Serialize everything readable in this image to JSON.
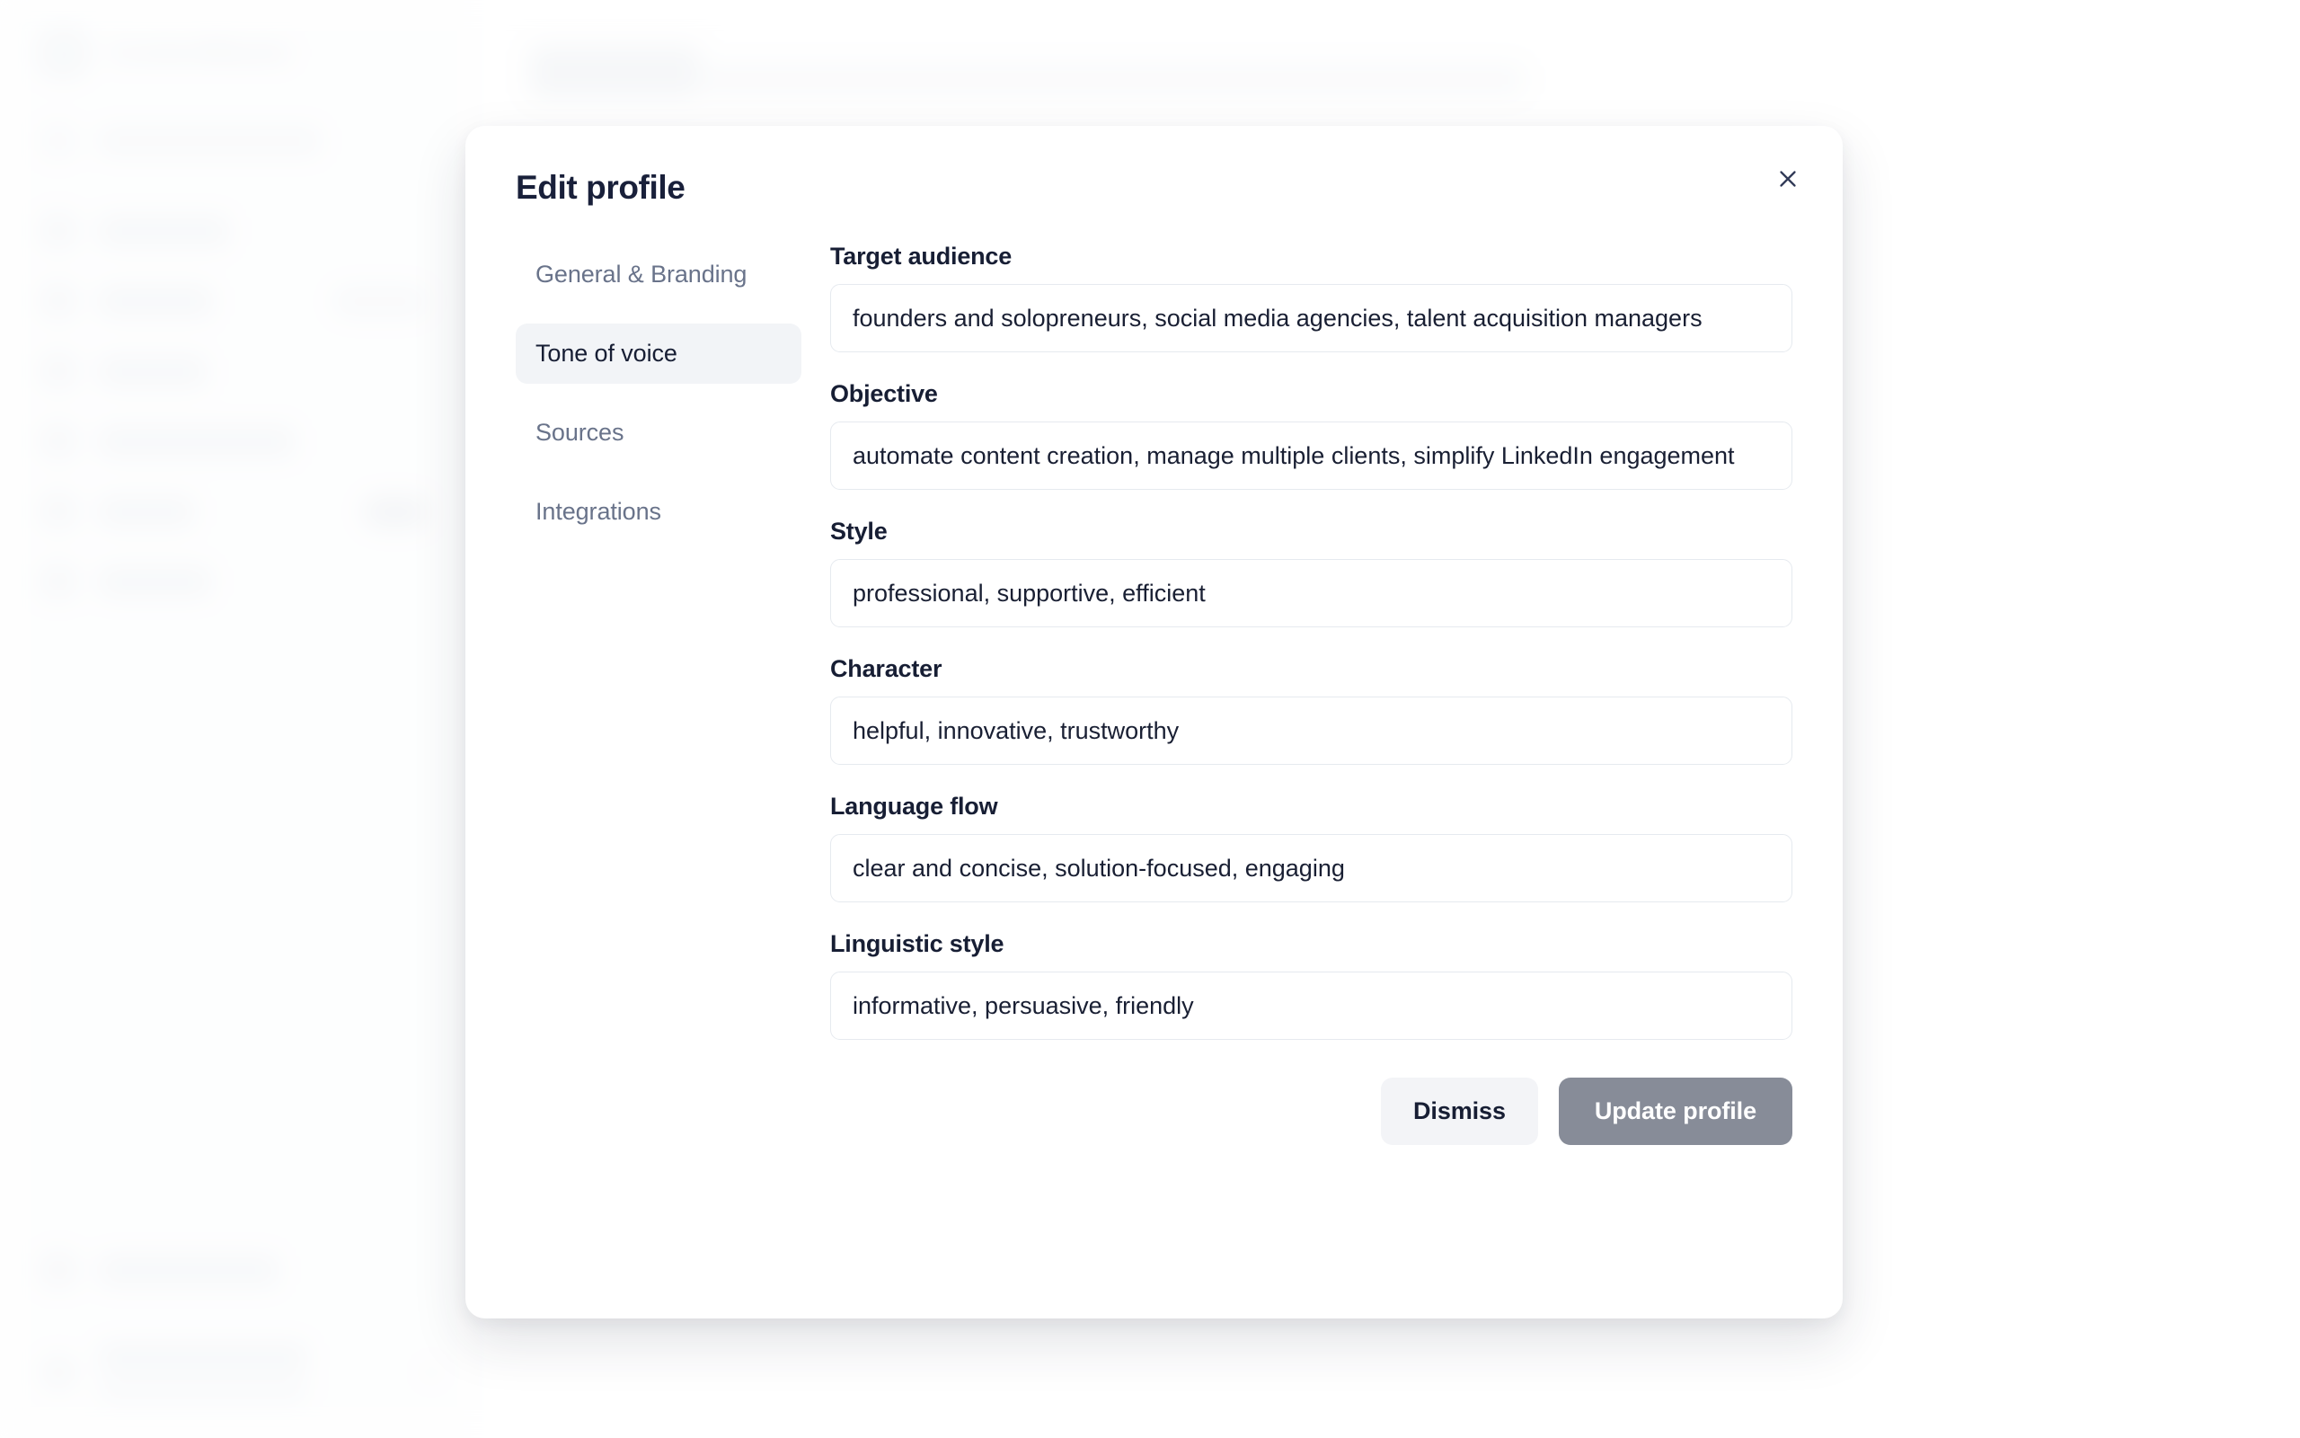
{
  "background": {
    "brand_name": "ContentMaster",
    "sidebar_top": [
      {
        "label": "New content assistant",
        "icon": "plus-icon"
      }
    ],
    "sidebar_items": [
      {
        "label": "Dashboard",
        "icon": "grid-icon",
        "tag": ""
      },
      {
        "label": "Assistant",
        "icon": "sparkle-icon",
        "tag": "Preview"
      },
      {
        "label": "All posts",
        "icon": "document-icon",
        "tag": ""
      },
      {
        "label": "Content calendar",
        "icon": "calendar-icon",
        "tag": ""
      },
      {
        "label": "Profiles",
        "icon": "user-icon",
        "tag": "New"
      },
      {
        "label": "Analytics",
        "icon": "chart-icon",
        "tag": ""
      }
    ],
    "sidebar_bottom": [
      {
        "label": "Leave feedback",
        "icon": "megaphone-icon"
      }
    ],
    "account": {
      "name": "ContentMaster",
      "email": "contact@contentmaster.io",
      "more_icon": "ellipsis-icon"
    },
    "page_title": "Profiles",
    "page_description": "Define your profiles, tone, and voice so the content connects with the right audience."
  },
  "modal": {
    "title": "Edit profile",
    "close_icon": "close-icon",
    "tabs": [
      {
        "id": "general-branding",
        "label": "General & Branding",
        "active": false
      },
      {
        "id": "tone-of-voice",
        "label": "Tone of voice",
        "active": true
      },
      {
        "id": "sources",
        "label": "Sources",
        "active": false
      },
      {
        "id": "integrations",
        "label": "Integrations",
        "active": false
      }
    ],
    "fields": [
      {
        "id": "target-audience",
        "label": "Target audience",
        "value": "founders and solopreneurs, social media agencies, talent acquisition managers",
        "placeholder": "Target audience"
      },
      {
        "id": "objective",
        "label": "Objective",
        "value": "automate content creation, manage multiple clients, simplify LinkedIn engagement",
        "placeholder": "Objective"
      },
      {
        "id": "style",
        "label": "Style",
        "value": "professional, supportive, efficient",
        "placeholder": "Style"
      },
      {
        "id": "character",
        "label": "Character",
        "value": "helpful, innovative, trustworthy",
        "placeholder": "Character"
      },
      {
        "id": "language-flow",
        "label": "Language flow",
        "value": "clear and concise, solution-focused, engaging",
        "placeholder": "Language flow"
      },
      {
        "id": "linguistic-style",
        "label": "Linguistic style",
        "value": "informative, persuasive, friendly",
        "placeholder": "Linguistic style"
      }
    ],
    "footer": {
      "dismiss_label": "Dismiss",
      "update_label": "Update profile"
    }
  },
  "colors": {
    "text_primary": "#171e34",
    "text_muted": "#69738a",
    "tab_active_bg": "#f2f4f7",
    "primary_button_bg": "#878c98",
    "secondary_button_bg": "#f3f4f7",
    "input_border": "#e6eaef",
    "modal_bg": "#ffffff"
  }
}
